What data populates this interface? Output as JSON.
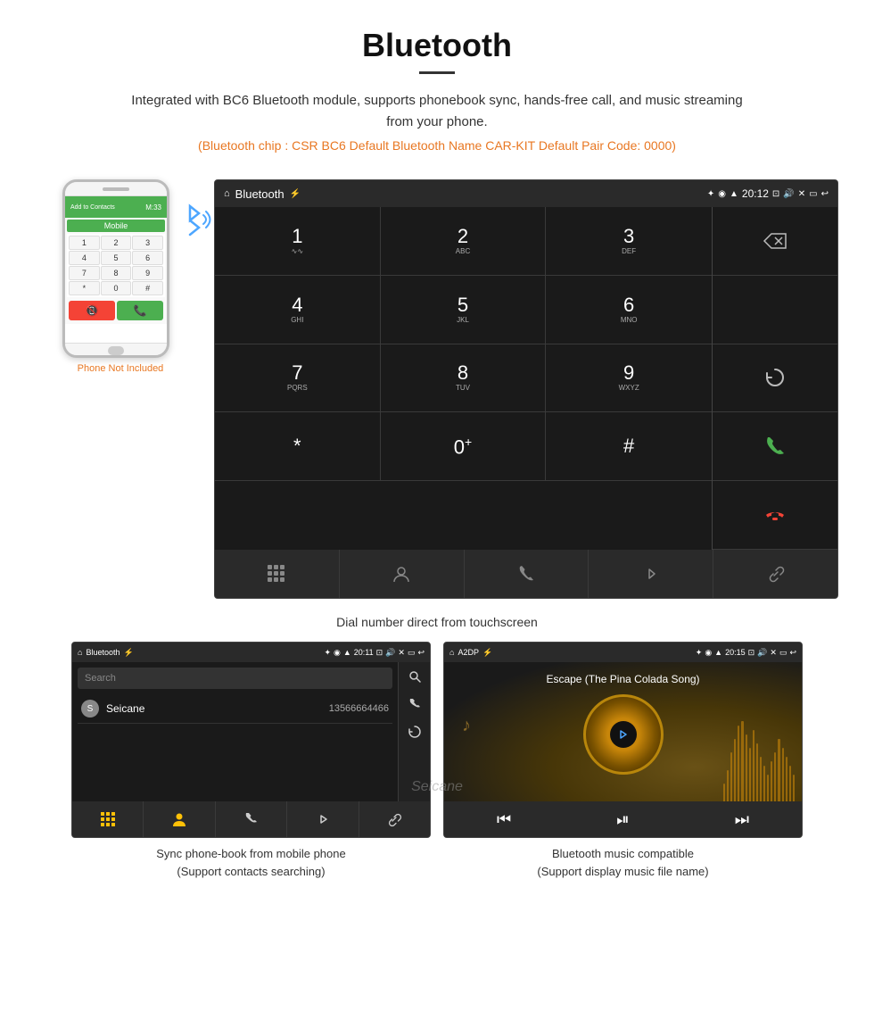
{
  "header": {
    "title": "Bluetooth",
    "description": "Integrated with BC6 Bluetooth module, supports phonebook sync, hands-free call, and music streaming from your phone.",
    "specs": "(Bluetooth chip : CSR BC6   Default Bluetooth Name CAR-KIT    Default Pair Code: 0000)"
  },
  "dialpad_screen": {
    "statusbar": {
      "title": "Bluetooth",
      "time": "20:12"
    },
    "keys": [
      {
        "num": "1",
        "letters": "∿∿"
      },
      {
        "num": "2",
        "letters": "ABC"
      },
      {
        "num": "3",
        "letters": "DEF"
      },
      {
        "num": "4",
        "letters": "GHI"
      },
      {
        "num": "5",
        "letters": "JKL"
      },
      {
        "num": "6",
        "letters": "MNO"
      },
      {
        "num": "7",
        "letters": "PQRS"
      },
      {
        "num": "8",
        "letters": "TUV"
      },
      {
        "num": "9",
        "letters": "WXYZ"
      },
      {
        "num": "*",
        "letters": ""
      },
      {
        "num": "0",
        "letters": "+"
      },
      {
        "num": "#",
        "letters": ""
      }
    ],
    "caption": "Dial number direct from touchscreen"
  },
  "phonebook_screen": {
    "statusbar": {
      "title": "Bluetooth",
      "time": "20:11"
    },
    "search_placeholder": "Search",
    "contacts": [
      {
        "letter": "S",
        "name": "Seicane",
        "number": "13566664466"
      }
    ],
    "caption_line1": "Sync phone-book from mobile phone",
    "caption_line2": "(Support contacts searching)"
  },
  "music_screen": {
    "statusbar": {
      "title": "A2DP",
      "time": "20:15"
    },
    "song_title": "Escape (The Pina Colada Song)",
    "eq_bars": [
      20,
      35,
      55,
      70,
      85,
      90,
      75,
      60,
      80,
      65,
      50,
      40,
      30,
      45,
      55,
      70,
      60,
      50,
      40,
      30
    ],
    "caption_line1": "Bluetooth music compatible",
    "caption_line2": "(Support display music file name)"
  },
  "phone_label": "Phone Not Included",
  "watermark": "Seicane"
}
